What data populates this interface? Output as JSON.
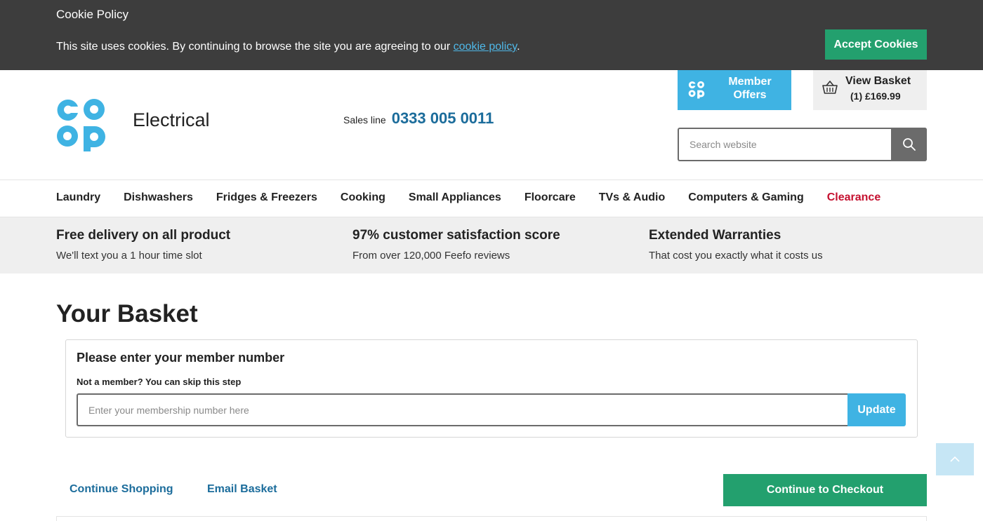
{
  "cookie": {
    "title": "Cookie Policy",
    "text_before": "This site uses cookies. By continuing to browse the site you are agreeing to our ",
    "link": "cookie policy",
    "text_after": ".",
    "accept_label": "Accept Cookies"
  },
  "header": {
    "brand": "Electrical",
    "sales_label": "Sales line",
    "sales_phone": "0333 005 0011",
    "member_offers": "Member Offers",
    "basket_title": "View Basket",
    "basket_summary": "(1) £169.99",
    "search_placeholder": "Search website"
  },
  "nav": {
    "items": [
      "Laundry",
      "Dishwashers",
      "Fridges & Freezers",
      "Cooking",
      "Small Appliances",
      "Floorcare",
      "TVs & Audio",
      "Computers & Gaming",
      "Clearance"
    ]
  },
  "usp": [
    {
      "title": "Free delivery on all product",
      "subtitle": "We'll text you a 1 hour time slot"
    },
    {
      "title": "97% customer satisfaction score",
      "subtitle": "From over 120,000 Feefo reviews"
    },
    {
      "title": "Extended Warranties",
      "subtitle": "That cost you exactly what it costs us"
    }
  ],
  "basket": {
    "title": "Your Basket",
    "member_heading": "Please enter your member number",
    "member_sub": "Not a member? You can skip this step",
    "member_placeholder": "Enter your membership number here",
    "update_label": "Update",
    "continue_shopping": "Continue Shopping",
    "email_basket": "Email Basket",
    "checkout_label": "Continue to Checkout"
  },
  "colors": {
    "cookie_bg": "#3d3d3d",
    "green": "#23a06e",
    "coop_blue": "#3fb3e3",
    "link_blue": "#1b6c9b",
    "clearance_red": "#c5102f"
  }
}
